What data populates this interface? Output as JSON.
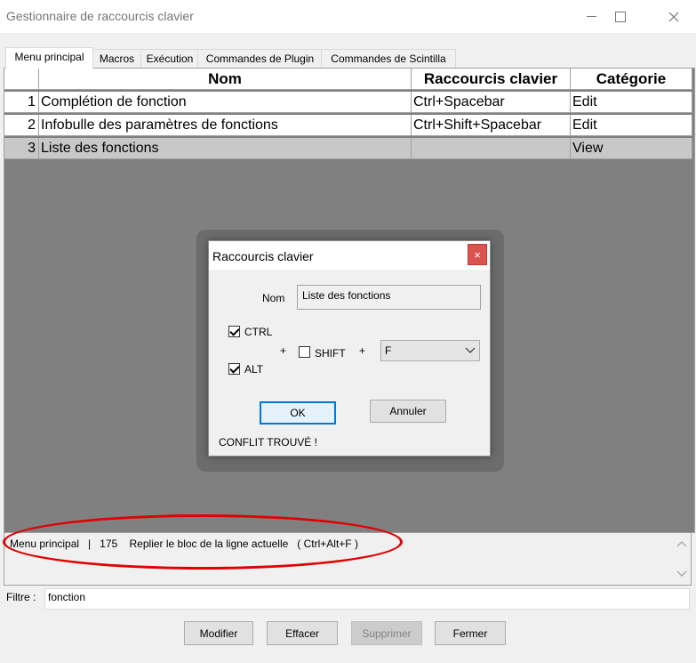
{
  "window": {
    "title": "Gestionnaire de raccourcis clavier"
  },
  "tabs": [
    {
      "label": "Menu principal",
      "active": true
    },
    {
      "label": "Macros"
    },
    {
      "label": "Exécution"
    },
    {
      "label": "Commandes de Plugin"
    },
    {
      "label": "Commandes de Scintilla"
    }
  ],
  "table": {
    "headers": [
      "Nom",
      "Raccourcis clavier",
      "Catégorie"
    ],
    "rows": [
      {
        "num": "1",
        "name": "Complétion de fonction",
        "shortcut": "Ctrl+Spacebar",
        "category": "Edit"
      },
      {
        "num": "2",
        "name": "Infobulle des paramètres de fonctions",
        "shortcut": "Ctrl+Shift+Spacebar",
        "category": "Edit"
      },
      {
        "num": "3",
        "name": "Liste des fonctions",
        "shortcut": "",
        "category": "View"
      }
    ]
  },
  "dialog": {
    "title": "Raccourcis clavier",
    "close_glyph": "×",
    "name_label": "Nom",
    "name_value": "Liste des fonctions",
    "ctrl_label": "CTRL",
    "alt_label": "ALT",
    "shift_label": "SHIFT",
    "plus": "+",
    "key_value": "F",
    "ok_label": "OK",
    "cancel_label": "Annuler",
    "conflict_text": "CONFLIT TROUVÉ !",
    "ctrl_checked": true,
    "alt_checked": true,
    "shift_checked": false
  },
  "status": {
    "text": "Menu principal   |   175    Replier le bloc de la ligne actuelle   ( Ctrl+Alt+F )"
  },
  "filter": {
    "label": "Filtre :",
    "value": "fonction"
  },
  "buttons": {
    "modify": "Modifier",
    "clear": "Effacer",
    "delete": "Supprimer",
    "close": "Fermer"
  },
  "colors": {
    "annotation": "#e00000",
    "accent": "#0078d7"
  }
}
